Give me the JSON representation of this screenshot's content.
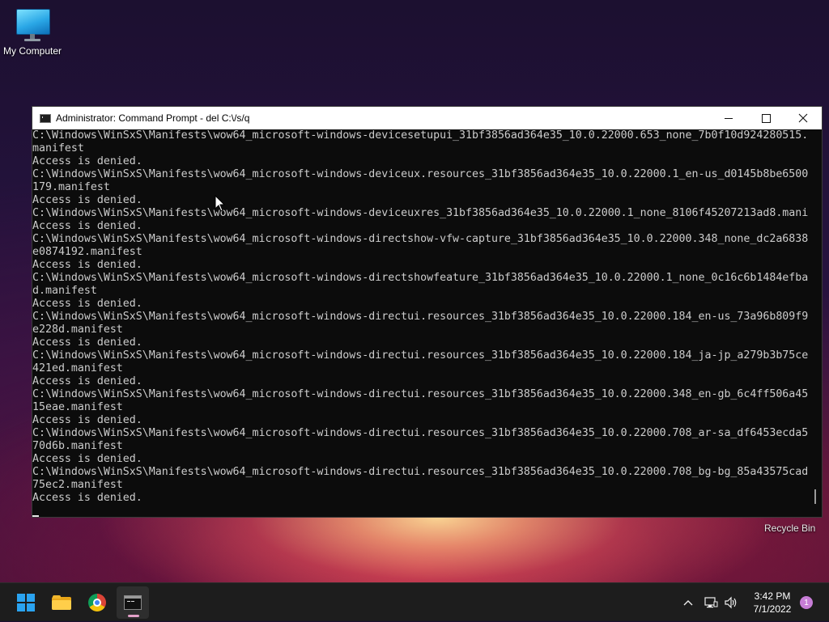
{
  "desktop": {
    "icons": [
      {
        "label": "My Computer",
        "icon": "monitor-icon"
      },
      {
        "label": "Recycle Bin",
        "icon": "recycle-bin-icon"
      }
    ]
  },
  "window": {
    "title": "Administrator: Command Prompt - del  C:\\/s/q",
    "buttons": {
      "minimize": "minimize",
      "maximize": "maximize",
      "close": "close"
    }
  },
  "console": {
    "lines": [
      "C:\\Windows\\WinSxS\\Manifests\\wow64_microsoft-windows-devicesetupui_31bf3856ad364e35_10.0.22000.653_none_7b0f10d924280515.",
      "manifest",
      "Access is denied.",
      "C:\\Windows\\WinSxS\\Manifests\\wow64_microsoft-windows-deviceux.resources_31bf3856ad364e35_10.0.22000.1_en-us_d0145b8be6500",
      "179.manifest",
      "Access is denied.",
      "C:\\Windows\\WinSxS\\Manifests\\wow64_microsoft-windows-deviceuxres_31bf3856ad364e35_10.0.22000.1_none_8106f45207213ad8.mani",
      "Access is denied.",
      "C:\\Windows\\WinSxS\\Manifests\\wow64_microsoft-windows-directshow-vfw-capture_31bf3856ad364e35_10.0.22000.348_none_dc2a6838",
      "e0874192.manifest",
      "Access is denied.",
      "C:\\Windows\\WinSxS\\Manifests\\wow64_microsoft-windows-directshowfeature_31bf3856ad364e35_10.0.22000.1_none_0c16c6b1484efba",
      "d.manifest",
      "Access is denied.",
      "C:\\Windows\\WinSxS\\Manifests\\wow64_microsoft-windows-directui.resources_31bf3856ad364e35_10.0.22000.184_en-us_73a96b809f9",
      "e228d.manifest",
      "Access is denied.",
      "C:\\Windows\\WinSxS\\Manifests\\wow64_microsoft-windows-directui.resources_31bf3856ad364e35_10.0.22000.184_ja-jp_a279b3b75ce",
      "421ed.manifest",
      "Access is denied.",
      "C:\\Windows\\WinSxS\\Manifests\\wow64_microsoft-windows-directui.resources_31bf3856ad364e35_10.0.22000.348_en-gb_6c4ff506a45",
      "15eae.manifest",
      "Access is denied.",
      "C:\\Windows\\WinSxS\\Manifests\\wow64_microsoft-windows-directui.resources_31bf3856ad364e35_10.0.22000.708_ar-sa_df6453ecda5",
      "70d6b.manifest",
      "Access is denied.",
      "C:\\Windows\\WinSxS\\Manifests\\wow64_microsoft-windows-directui.resources_31bf3856ad364e35_10.0.22000.708_bg-bg_85a43575cad",
      "75ec2.manifest",
      "Access is denied."
    ]
  },
  "taskbar": {
    "apps": [
      {
        "name": "start",
        "icon": "windows-start-icon"
      },
      {
        "name": "file-explorer",
        "icon": "folder-icon"
      },
      {
        "name": "chrome",
        "icon": "chrome-icon"
      },
      {
        "name": "command-prompt",
        "icon": "cmd-icon",
        "active": true
      }
    ],
    "tray": {
      "time": "3:42 PM",
      "date": "7/1/2022",
      "notification_count": "1"
    }
  },
  "colors": {
    "console_bg": "#0c0c0c",
    "console_fg": "#cccccc",
    "taskbar_bg": "#1d1d1d",
    "start_blue": "#2aa3f0"
  }
}
